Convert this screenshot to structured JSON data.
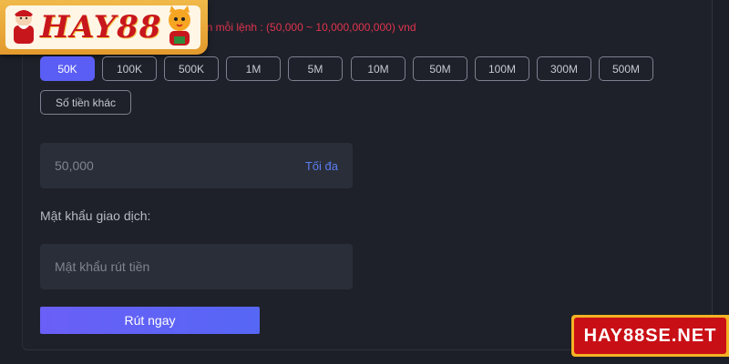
{
  "limit_text": "ền mỗi lệnh : (50,000 ~ 10,000,000,000) vnd",
  "logo": {
    "text": "HAY88",
    "alt": "HAY88 logo"
  },
  "amount_chips": [
    {
      "label": "50K",
      "active": true
    },
    {
      "label": "100K",
      "active": false
    },
    {
      "label": "500K",
      "active": false
    },
    {
      "label": "1M",
      "active": false
    },
    {
      "label": "5M",
      "active": false
    },
    {
      "label": "10M",
      "active": false
    },
    {
      "label": "50M",
      "active": false
    },
    {
      "label": "100M",
      "active": false
    },
    {
      "label": "300M",
      "active": false
    },
    {
      "label": "500M",
      "active": false
    }
  ],
  "other_amount_label": "Số tiền khác",
  "amount_input": {
    "placeholder": "50,000",
    "max_label": "Tối đa"
  },
  "password": {
    "label": "Mật khẩu giao dịch:",
    "placeholder": "Mật khẩu rút tiền"
  },
  "submit_label": "Rút ngay",
  "site_badge": "HAY88SE.NET",
  "colors": {
    "accent": "#5b5ef5",
    "background": "#1c1f27",
    "input_bg": "#2a2e38",
    "warning": "#e0334f",
    "badge_red": "#c90f16",
    "badge_gold": "#f3b324"
  }
}
